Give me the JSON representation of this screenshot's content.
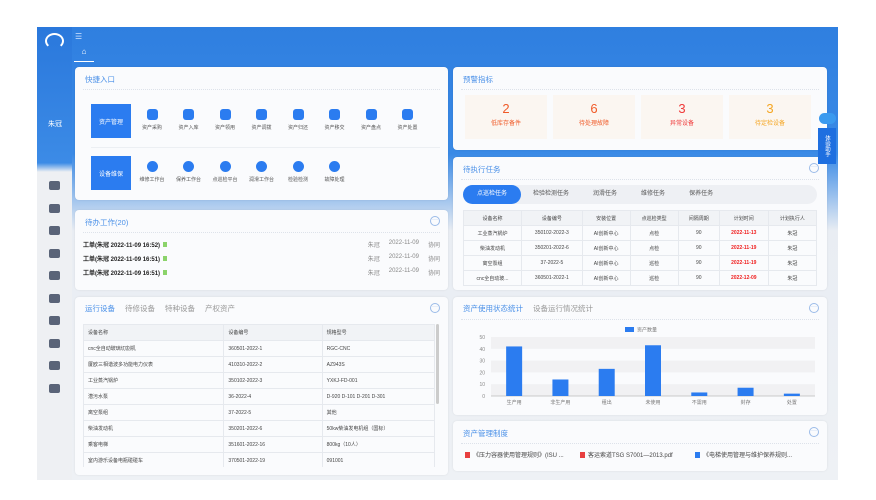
{
  "sidebar": {
    "user": "朱冠",
    "icons": [
      "dashboard-icon",
      "edit-icon",
      "document-icon",
      "folder-settings-icon",
      "share-nodes-icon",
      "monitor-icon",
      "form-edit-icon",
      "report-icon",
      "finance-icon",
      "chart-monitor-icon"
    ]
  },
  "header": {
    "home": "⌂",
    "menu": "☰"
  },
  "quick": {
    "title": "快捷入口",
    "asset": {
      "label": "资产管理",
      "items": [
        "资产采购",
        "资产入库",
        "资产领用",
        "资产调拨",
        "资产归还",
        "资产移交",
        "资产盘点",
        "资产处置"
      ]
    },
    "maint": {
      "label": "设备维保",
      "items": [
        "维修工作台",
        "保养工作台",
        "点巡检平台",
        "润滑工作台",
        "检验检测",
        "故障处理"
      ]
    }
  },
  "todo": {
    "title": "待办工作(20)",
    "items": [
      {
        "text": "工单(朱冠 2022-11-09 16:52)",
        "user": "朱冠",
        "date": "2022-11-09",
        "type": "协同"
      },
      {
        "text": "工单(朱冠 2022-11-09 16:51)",
        "user": "朱冠",
        "date": "2022-11-09",
        "type": "协同"
      },
      {
        "text": "工单(朱冠 2022-11-09 16:51)",
        "user": "朱冠",
        "date": "2022-11-09",
        "type": "协同"
      }
    ]
  },
  "equip": {
    "tabs": [
      "运行设备",
      "待修设备",
      "特种设备",
      "产权资产"
    ],
    "headers": [
      "设备名称",
      "设备编号",
      "规格型号"
    ],
    "rows": [
      [
        "cnc全自动玻璃切割机",
        "360501-2022-1",
        "RGC-CNC"
      ],
      [
        "厦欧三相谐波多功能电力仪表",
        "410310-2022-2",
        "AZ943S"
      ],
      [
        "工业蒸汽锅炉",
        "350102-2022-3",
        "YXKJ-FD-001"
      ],
      [
        "潜污水泵",
        "36-2022-4",
        "D-920 D-101 D-201 D-301"
      ],
      [
        "离空泵组",
        "37-2022-5",
        "其他"
      ],
      [
        "柴油发动机",
        "350201-2022-6",
        "50kw柴油发电机组（国标）"
      ],
      [
        "乘客电梯",
        "351601-2022-16",
        "800kg（10人）"
      ],
      [
        "室内游乐设备电瓶碰碰车",
        "370501-2022-19",
        "091001"
      ]
    ]
  },
  "warn": {
    "title": "预警指标",
    "items": [
      {
        "n": "2",
        "l": "低库存备件",
        "c": "#f05a28"
      },
      {
        "n": "6",
        "l": "待处理故障",
        "c": "#f05a28"
      },
      {
        "n": "3",
        "l": "异常设备",
        "c": "#f03a3a"
      },
      {
        "n": "3",
        "l": "待定检设备",
        "c": "#f5a623"
      }
    ]
  },
  "tasks": {
    "title": "待执行任务",
    "tabs": [
      "点巡检任务",
      "检验检测任务",
      "润滑任务",
      "维修任务",
      "保养任务"
    ],
    "headers": [
      "设备名称",
      "设备编号",
      "安装位置",
      "点巡检类型",
      "间隔周期",
      "计划时间",
      "计划执行人"
    ],
    "rows": [
      [
        "工业蒸汽锅炉",
        "350102-2022-3",
        "AI创新中心",
        "点检",
        "90",
        "2022-11-13",
        "朱冠"
      ],
      [
        "柴油发动机",
        "350201-2022-6",
        "AI创新中心",
        "点检",
        "90",
        "2022-11-19",
        "朱冠"
      ],
      [
        "离空泵组",
        "37-2022-5",
        "AI创新中心",
        "巡检",
        "90",
        "2022-11-19",
        "朱冠"
      ],
      [
        "cnc全自动玻...",
        "360501-2022-1",
        "AI创新中心",
        "巡检",
        "90",
        "2022-12-09",
        "朱冠"
      ]
    ]
  },
  "stats": {
    "tabs": [
      "资产使用状态统计",
      "设备运行情况统计"
    ]
  },
  "chart_data": {
    "type": "bar",
    "categories": [
      "生产用",
      "非生产用",
      "租出",
      "未使用",
      "不需用",
      "封存",
      "处置"
    ],
    "series": [
      {
        "name": "资产数量",
        "values": [
          42,
          14,
          23,
          43,
          3,
          7,
          2
        ]
      }
    ],
    "ylim": [
      0,
      50
    ],
    "yticks": [
      0,
      10,
      20,
      30,
      40,
      50
    ],
    "legend": "top",
    "color": "#2b7cf0",
    "grid": "banded"
  },
  "docs": {
    "title": "资产管理制度",
    "items": [
      {
        "t": "《压力容器使用管理规则》(ISU ...",
        "c": "pdf"
      },
      {
        "t": "客运索道TSG S7001—2013.pdf",
        "c": "pdf"
      },
      {
        "t": "《电梯使用管理与维护保养规则...",
        "c": "doc"
      }
    ]
  },
  "assistant": {
    "label": "体验助手"
  }
}
